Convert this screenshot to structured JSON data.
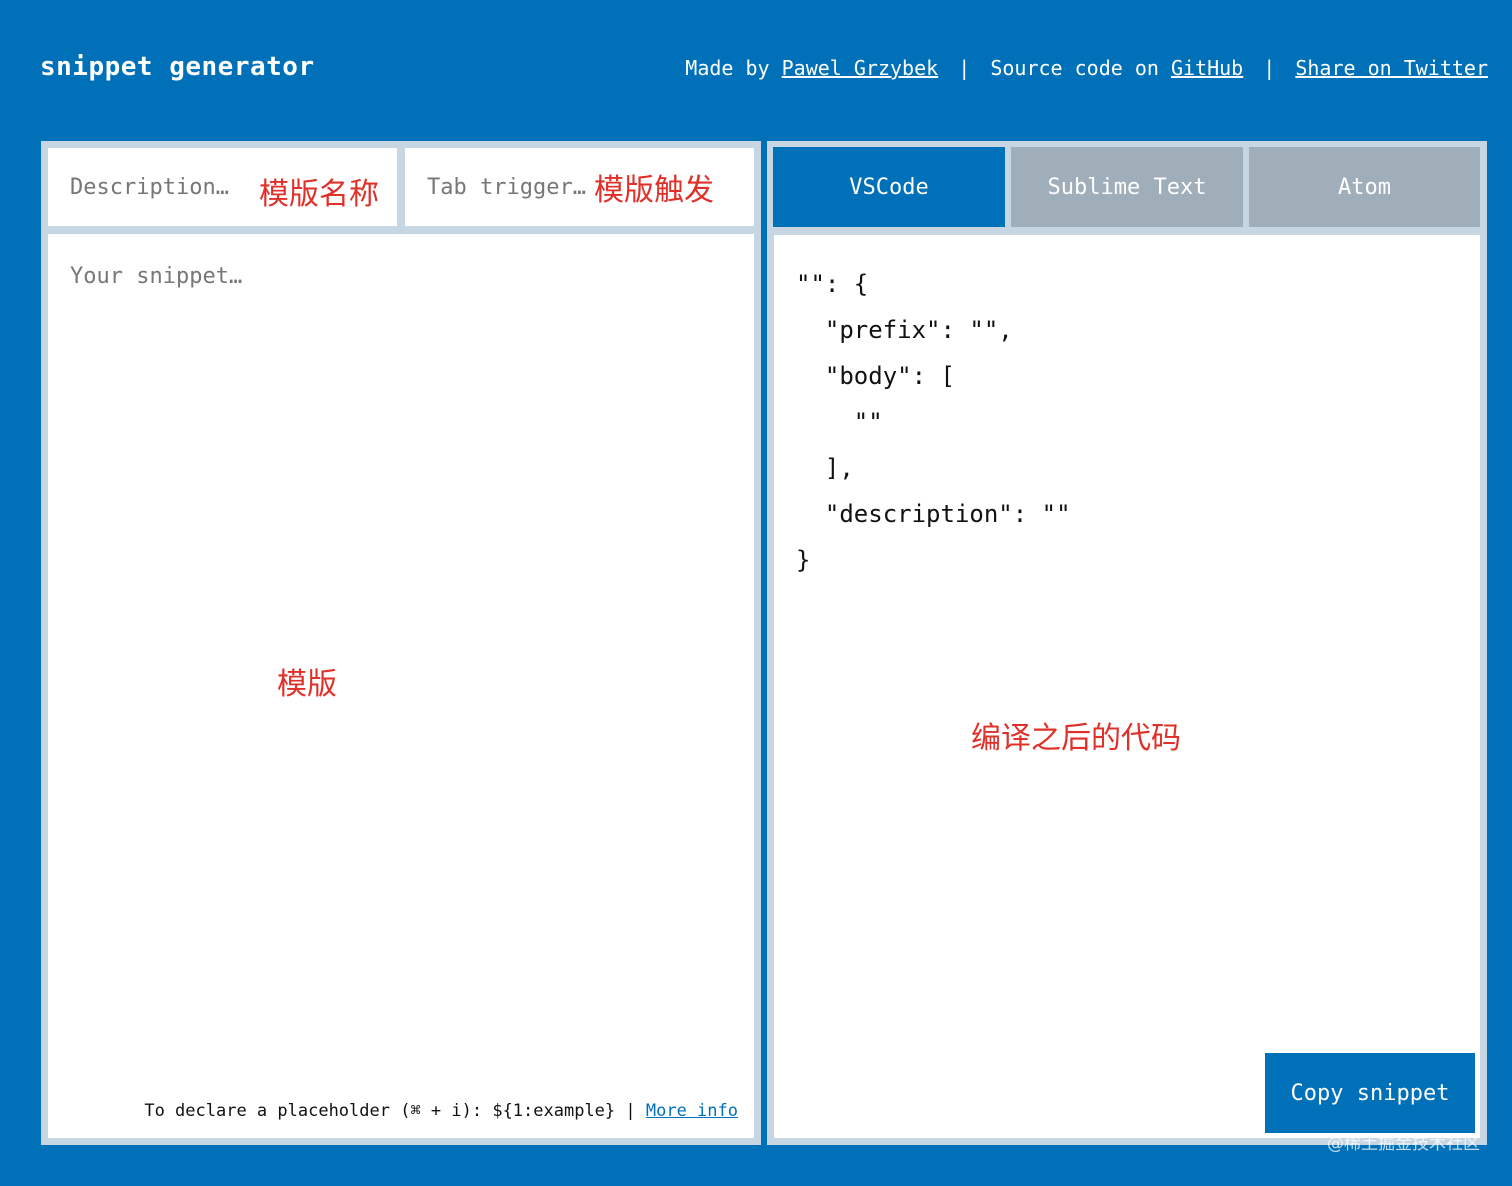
{
  "header": {
    "title": "snippet generator",
    "made_by_prefix": "Made by",
    "author_link": "Pawel Grzybek",
    "separator": "|",
    "source_prefix": "Source code on",
    "github_link": "GitHub",
    "share_link": "Share on Twitter"
  },
  "editor": {
    "description_placeholder": "Description…",
    "trigger_placeholder": "Tab trigger…",
    "snippet_placeholder": "Your snippet…",
    "hint_text": "To declare a placeholder (⌘ + i): ${1:example} |",
    "more_info_link": "More info"
  },
  "annotations": {
    "template_name": "模版名称",
    "template_trigger": "模版触发",
    "template": "模版",
    "compiled_code": "编译之后的代码"
  },
  "tabs": [
    {
      "label": "VSCode",
      "active": true
    },
    {
      "label": "Sublime Text",
      "active": false
    },
    {
      "label": "Atom",
      "active": false
    }
  ],
  "output": {
    "code": "\"\": {\n  \"prefix\": \"\",\n  \"body\": [\n    \"\"\n  ],\n  \"description\": \"\"\n}"
  },
  "copy_button": "Copy snippet",
  "watermark": "@稀土掘金技术社区",
  "colors": {
    "brand": "#0071b8",
    "panel": "#c7d6e3",
    "tab_inactive": "#a0aeba",
    "annotation": "#e0302a"
  }
}
